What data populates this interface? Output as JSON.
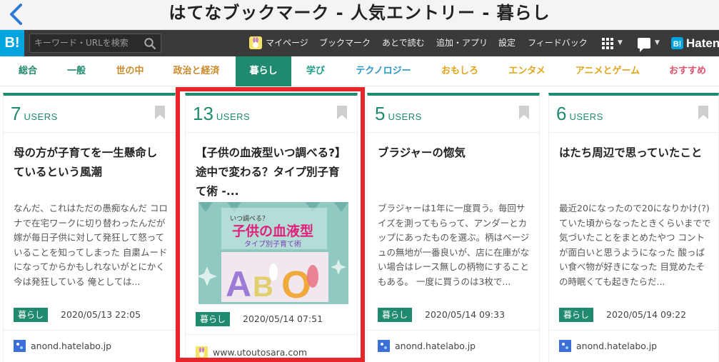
{
  "title_bar": {
    "title": "はてなブックマーク - 人気エントリー - 暮らし"
  },
  "header": {
    "logo_text": "B!",
    "search_placeholder": "キーワード・URLを検索",
    "nav": [
      "マイページ",
      "ブックマーク",
      "あとで読む",
      "追加・アプリ",
      "設定",
      "フィードバック"
    ],
    "brand": "Haten"
  },
  "tabs": [
    {
      "label": "総合",
      "color": "#1f8a6e",
      "active": false
    },
    {
      "label": "一般",
      "color": "#1f8a6e",
      "active": false
    },
    {
      "label": "世の中",
      "color": "#c98a2b",
      "active": false
    },
    {
      "label": "政治と経済",
      "color": "#c98a2b",
      "active": false
    },
    {
      "label": "暮らし",
      "color": "#ffffff",
      "active": true
    },
    {
      "label": "学び",
      "color": "#1e9e88",
      "active": false
    },
    {
      "label": "テクノロジー",
      "color": "#2897c8",
      "active": false
    },
    {
      "label": "おもしろ",
      "color": "#e0a51c",
      "active": false
    },
    {
      "label": "エンタメ",
      "color": "#e0a51c",
      "active": false
    },
    {
      "label": "アニメとゲーム",
      "color": "#e0a51c",
      "active": false
    },
    {
      "label": "おすすめ",
      "color": "#e0516d",
      "active": false
    }
  ],
  "cards": [
    {
      "users": "7",
      "users_label": "USERS",
      "title": "母の方が子育てを一生懸命しているという風潮",
      "summary": "なんだ、これはただの愚痴なんだ コロナで在宅ワークに切り替わったんだが嫁が毎日子供に対して発狂して怒っていることを知ってしまった 自粛ムードになってからかもしれないがとにかく今は発狂している 俺としては...",
      "tag": "暮らし",
      "date": "2020/05/13 22:05",
      "domain": "anond.hatelabo.jp"
    },
    {
      "users": "13",
      "users_label": "USERS",
      "title": "【子供の血液型いつ調べる?】途中で変わる？タイプ別子育て術 -...",
      "thumb_text": {
        "small": "いつ調べる？",
        "main": "子供の血液型",
        "sub": "タイプ別子育て術",
        "letters": [
          "A",
          "B",
          "O"
        ]
      },
      "tag": "暮らし",
      "date": "2020/05/14 07:51",
      "domain": "www.utoutosara.com"
    },
    {
      "users": "5",
      "users_label": "USERS",
      "title": "ブラジャーの惚気",
      "summary": "ブラジャーは1年に一度買う。毎回サイズを測ってもらって、アンダーとカップにあったものを選ぶ。柄はベージュの無地が一番良いが、店に在庫がない場合はレース無しの柄物にすることもある。 一度に買うのは3枚で...",
      "tag": "暮らし",
      "date": "2020/05/14 09:33",
      "domain": "anond.hatelabo.jp"
    },
    {
      "users": "6",
      "users_label": "USERS",
      "title": "はたち周辺で思っていたこと",
      "summary": "最近20になったので20になりかけ(?)ていた頃からなったときくらいまでで気づいたことをまとめたやつ コントが面白いと思うようになった 酸っぱい食べ物が好きになった 目覚めたその時眠くても起きたらだ...",
      "tag": "暮らし",
      "date": "2020/05/14 09:22",
      "domain": "anond.hatelabo.jp"
    }
  ],
  "colors": {
    "accent": "#1f8a6e",
    "highlight": "#e8252b",
    "logo": "#00a4de"
  }
}
